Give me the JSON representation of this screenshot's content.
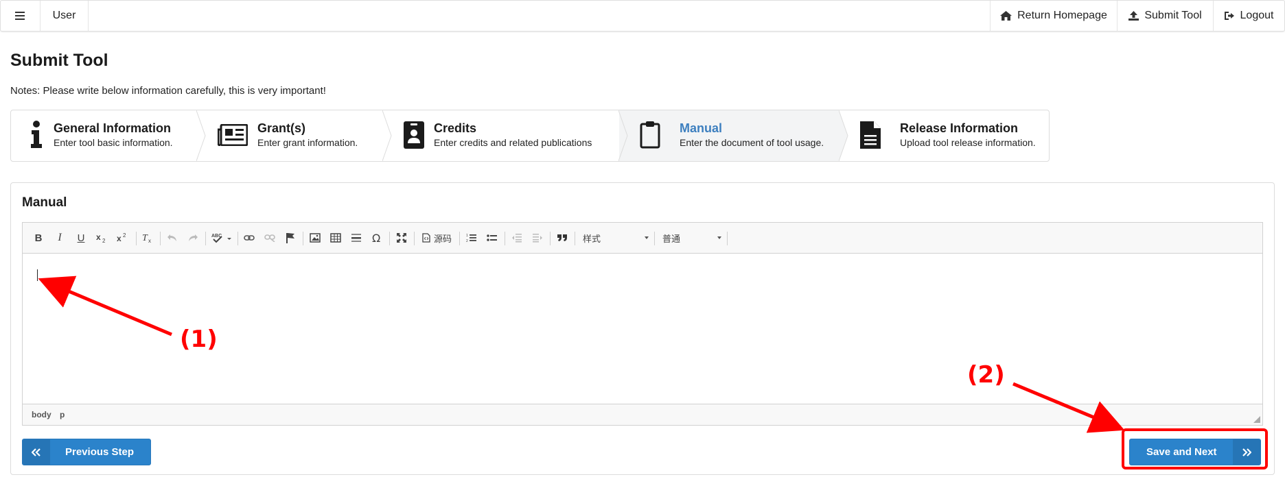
{
  "nav": {
    "menu_icon": "hamburger-icon",
    "user": "User",
    "return_homepage": "Return Homepage",
    "submit_tool": "Submit Tool",
    "logout": "Logout"
  },
  "page": {
    "title": "Submit Tool",
    "notes": "Notes: Please write below information carefully, this is very important!"
  },
  "steps": [
    {
      "title": "General Information",
      "desc": "Enter tool basic information.",
      "icon": "info-icon"
    },
    {
      "title": "Grant(s)",
      "desc": "Enter grant information.",
      "icon": "newspaper-icon"
    },
    {
      "title": "Credits",
      "desc": "Enter credits and related publications",
      "icon": "id-badge-icon"
    },
    {
      "title": "Manual",
      "desc": "Enter the document of tool usage.",
      "icon": "clipboard-icon",
      "active": true
    },
    {
      "title": "Release Information",
      "desc": "Upload tool release information.",
      "icon": "file-text-icon"
    }
  ],
  "panel": {
    "title": "Manual"
  },
  "editor": {
    "bold": "B",
    "italic": "I",
    "underline": "U",
    "source_label": "源码",
    "style_select": "样式",
    "format_select": "普通",
    "path": [
      "body",
      "p"
    ]
  },
  "buttons": {
    "previous": "Previous Step",
    "save_next": "Save and Next"
  },
  "annotations": {
    "label1": "(1)",
    "label2": "(2)"
  },
  "colors": {
    "primary_button": "#2b83cb",
    "active_step_title": "#3d7fbf",
    "annotation": "#ff0000"
  }
}
